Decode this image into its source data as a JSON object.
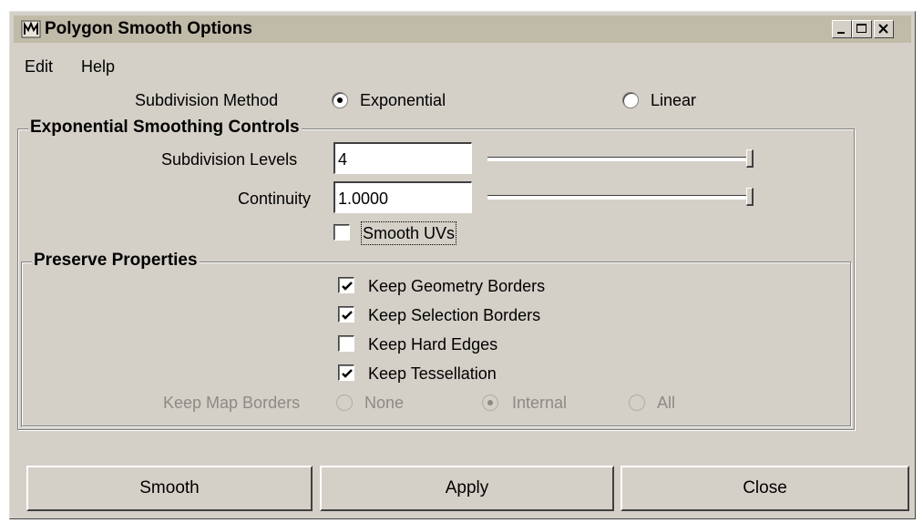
{
  "window": {
    "title": "Polygon Smooth Options",
    "icon": "maya-icon"
  },
  "titlebar_buttons": [
    {
      "name": "minimize-button",
      "icon": "minimize-icon"
    },
    {
      "name": "maximize-button",
      "icon": "maximize-icon"
    },
    {
      "name": "close-window-button",
      "icon": "close-icon"
    }
  ],
  "menu": {
    "edit": "Edit",
    "help": "Help"
  },
  "subdivision_method": {
    "label": "Subdivision Method",
    "options": [
      "Exponential",
      "Linear"
    ],
    "selected": "Exponential"
  },
  "exponential_controls": {
    "title": "Exponential Smoothing Controls",
    "subdivision_levels": {
      "label": "Subdivision Levels",
      "value": "4",
      "slider_fraction": 1.0
    },
    "continuity": {
      "label": "Continuity",
      "value": "1.0000",
      "slider_fraction": 1.0
    },
    "smooth_uvs": {
      "label": "Smooth UVs",
      "checked": false
    }
  },
  "preserve": {
    "title": "Preserve Properties",
    "keep_geometry_borders": {
      "label": "Keep Geometry Borders",
      "checked": true
    },
    "keep_selection_borders": {
      "label": "Keep Selection Borders",
      "checked": true
    },
    "keep_hard_edges": {
      "label": "Keep Hard Edges",
      "checked": false
    },
    "keep_tessellation": {
      "label": "Keep Tessellation",
      "checked": true
    },
    "keep_map_borders": {
      "label": "Keep Map Borders",
      "options": [
        "None",
        "Internal",
        "All"
      ],
      "selected": "Internal",
      "enabled": false
    }
  },
  "buttons": {
    "smooth": "Smooth",
    "apply": "Apply",
    "close": "Close"
  },
  "colors": {
    "face": "#d4d0c8",
    "titlebar": "#c0bba8",
    "disabled_text": "#8d8a85"
  }
}
